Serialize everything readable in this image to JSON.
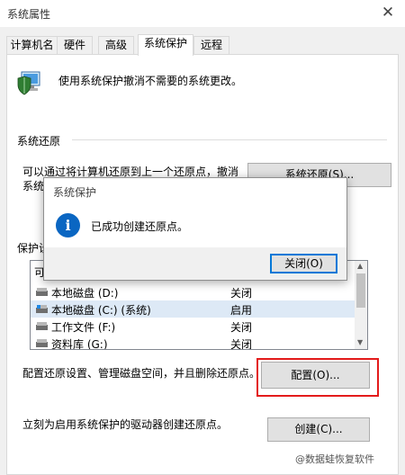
{
  "window": {
    "title": "系统属性",
    "close_glyph": "✕"
  },
  "tabs": [
    {
      "label": "计算机名"
    },
    {
      "label": "硬件"
    },
    {
      "label": "高级"
    },
    {
      "label": "系统保护",
      "active": true
    },
    {
      "label": "远程"
    }
  ],
  "header_text": "使用系统保护撤消不需要的系统更改。",
  "restore_section": {
    "label": "系统还原",
    "desc_line1": "可以通过将计算机还原到上一个还原点，撤消",
    "desc_line2": "系统",
    "button_label": "系统还原(S)..."
  },
  "protection_section": {
    "label": "保护设",
    "list_header": "可",
    "drives": [
      {
        "name": "本地磁盘 (D:)",
        "state": "关闭",
        "icon": "drive-icon"
      },
      {
        "name": "本地磁盘 (C:) (系统)",
        "state": "启用",
        "icon": "system-drive-icon",
        "selected": true
      },
      {
        "name": "工作文件 (F:)",
        "state": "关闭",
        "icon": "drive-icon"
      },
      {
        "name": "资料库 (G:)",
        "state": "关闭",
        "icon": "drive-icon"
      }
    ],
    "config_text": "配置还原设置、管理磁盘空间，并且删除还原点。",
    "config_button": "配置(O)...",
    "create_text": "立刻为启用系统保护的驱动器创建还原点。",
    "create_button": "创建(C)..."
  },
  "dialog": {
    "title": "系统保护",
    "message": "已成功创建还原点。",
    "close_button": "关闭(O)",
    "icon": "info-icon"
  },
  "watermark": "@数据蛙恢复软件",
  "colors": {
    "highlight": "#e31b1b",
    "info": "#0a66c2",
    "focus": "#0078d7"
  }
}
